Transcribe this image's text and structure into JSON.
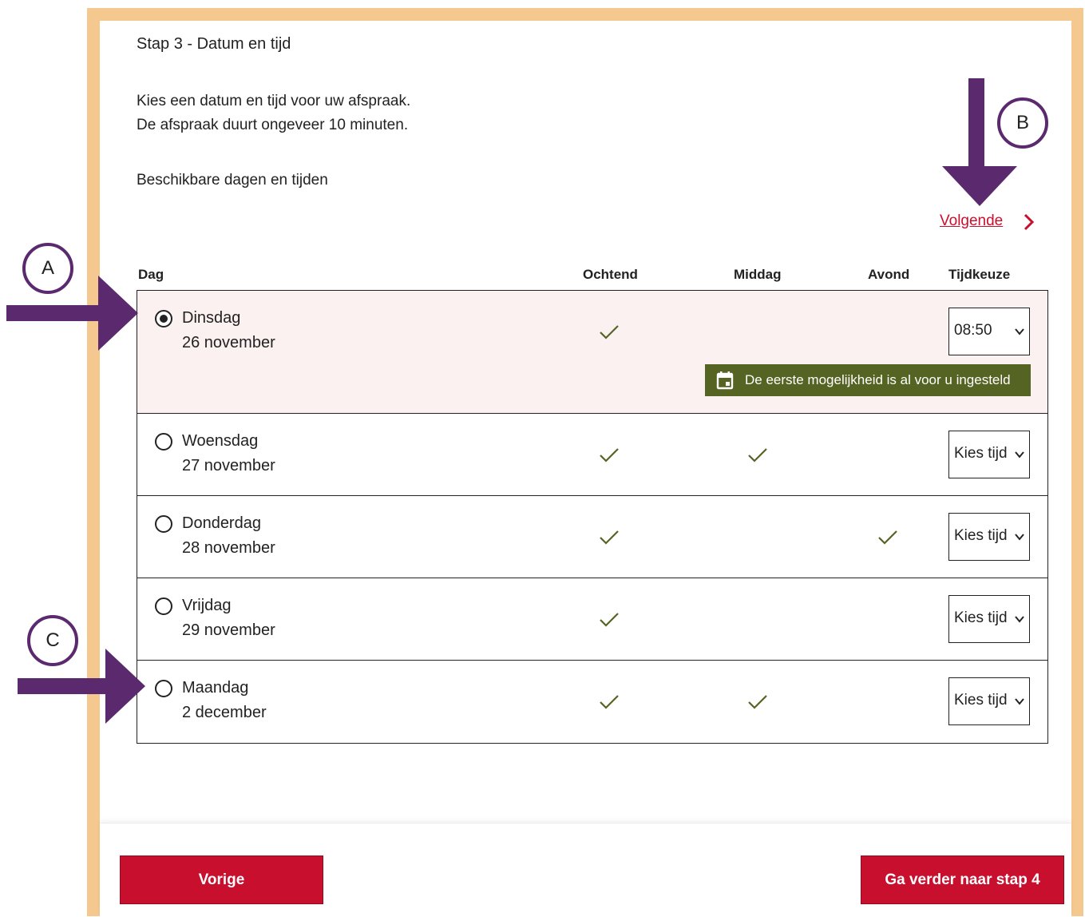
{
  "step_title": "Stap 3 - Datum en tijd",
  "intro_line1": "Kies een datum en tijd voor uw afspraak.",
  "intro_line2": "De afspraak duurt ongeveer 10 minuten.",
  "available_label": "Beschikbare dagen en tijden",
  "next_link": "Volgende",
  "columns": {
    "day": "Dag",
    "morning": "Ochtend",
    "afternoon": "Middag",
    "evening": "Avond",
    "time_choice": "Tijdkeuze"
  },
  "rows": [
    {
      "day": "Dinsdag",
      "date": "26 november",
      "selected": true,
      "morning": true,
      "afternoon": false,
      "evening": false,
      "time": "08:50"
    },
    {
      "day": "Woensdag",
      "date": "27 november",
      "selected": false,
      "morning": true,
      "afternoon": true,
      "evening": false,
      "time": "Kies tijd"
    },
    {
      "day": "Donderdag",
      "date": "28 november",
      "selected": false,
      "morning": true,
      "afternoon": false,
      "evening": true,
      "time": "Kies tijd"
    },
    {
      "day": "Vrijdag",
      "date": "29 november",
      "selected": false,
      "morning": true,
      "afternoon": false,
      "evening": false,
      "time": "Kies tijd"
    },
    {
      "day": "Maandag",
      "date": "2 december",
      "selected": false,
      "morning": true,
      "afternoon": true,
      "evening": false,
      "time": "Kies tijd"
    }
  ],
  "tooltip": "De eerste mogelijkheid is al voor u ingesteld",
  "buttons": {
    "previous": "Vorige",
    "next_step": "Ga verder naar stap 4"
  },
  "annotations": {
    "a": "A",
    "b": "B",
    "c": "C"
  },
  "colors": {
    "accent_red": "#c8102e",
    "tooltip_green": "#556323",
    "check_green": "#556323",
    "annotation_purple": "#5b2a6e",
    "frame_orange": "#f5c88f",
    "selected_row_bg": "#fbf1f1"
  }
}
